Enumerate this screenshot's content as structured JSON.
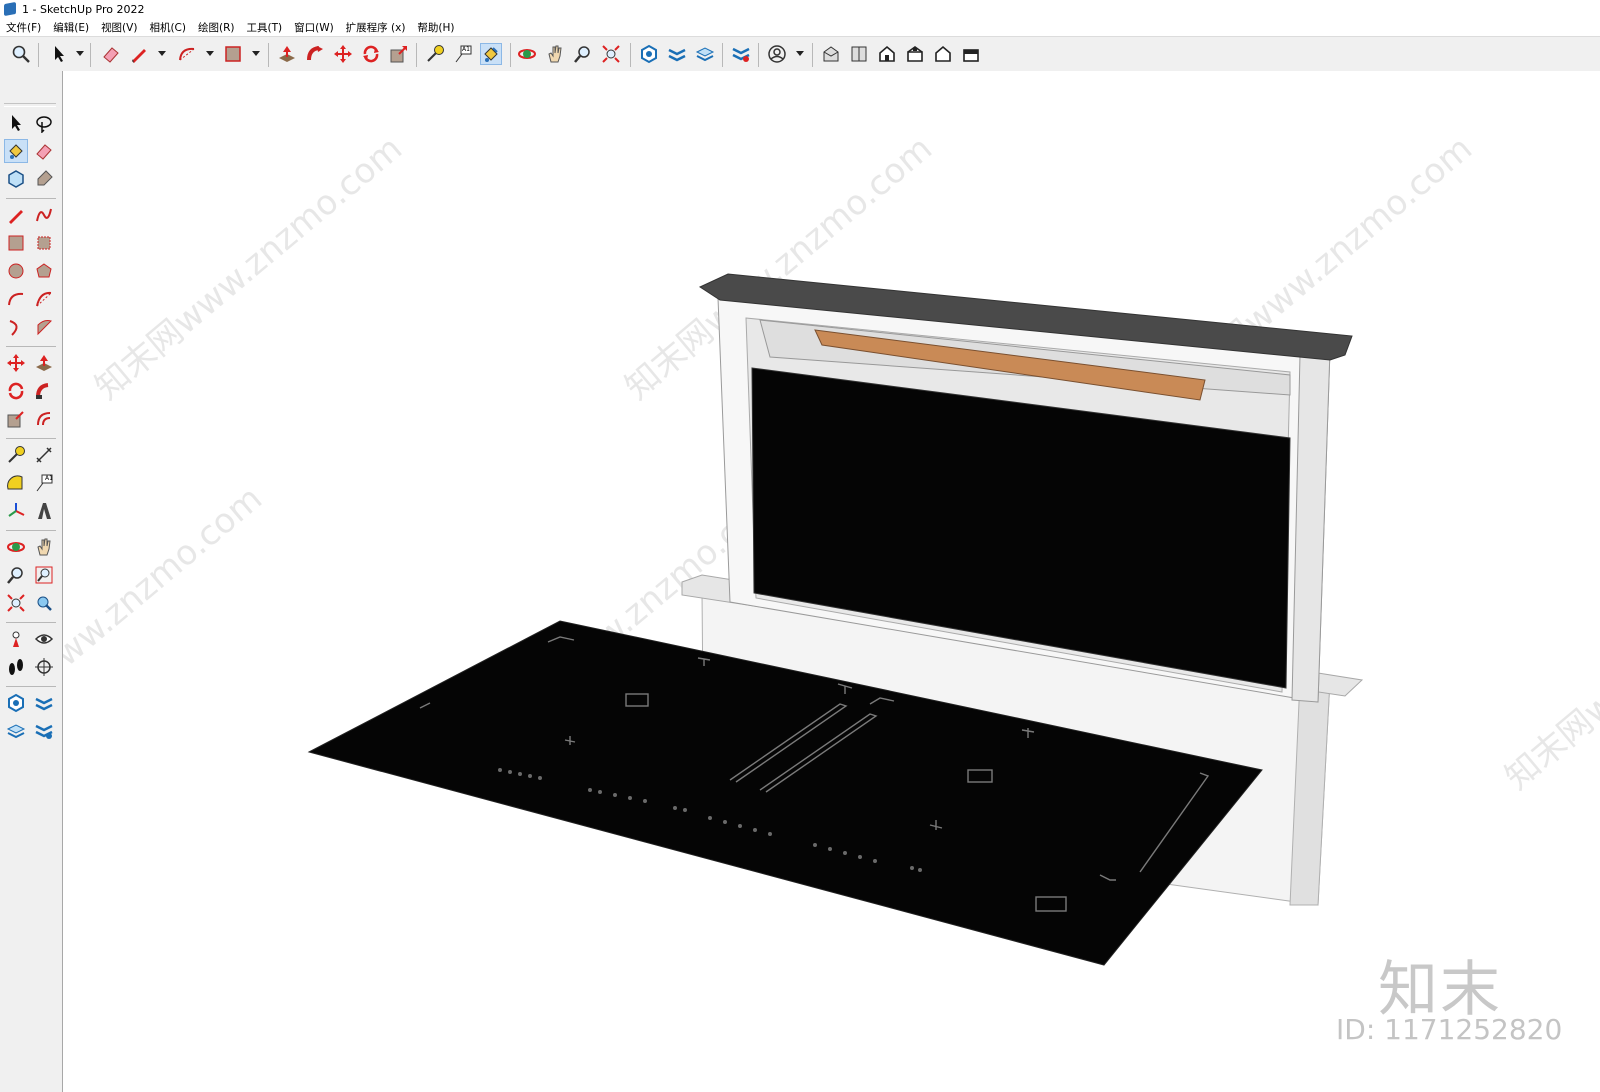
{
  "window": {
    "title": "1 - SketchUp Pro 2022"
  },
  "menubar": {
    "items": [
      "文件(F)",
      "编辑(E)",
      "视图(V)",
      "相机(C)",
      "绘图(R)",
      "工具(T)",
      "窗口(W)",
      "扩展程序 (x)",
      "帮助(H)"
    ]
  },
  "top_toolbar": {
    "icons": [
      "zoom-icon",
      "select-arrow-icon",
      "eraser-icon",
      "pencil-icon",
      "arc-icon",
      "rectangle-icon",
      "push-pull-icon",
      "follow-me-icon",
      "move-icon",
      "rotate-icon",
      "scale-icon",
      "tape-measure-icon",
      "text-icon",
      "paint-bucket-icon",
      "orbit-icon",
      "pan-icon",
      "zoom-tool-icon",
      "zoom-extents-icon",
      "warehouse-icon",
      "extension-warehouse-icon",
      "layout-icon",
      "styles-icon",
      "profile-icon",
      "iso-view-icon",
      "top-view-icon",
      "front-view-icon",
      "right-view-icon",
      "back-view-icon",
      "left-view-icon"
    ],
    "active": "paint-bucket-icon"
  },
  "left_toolbar": {
    "active": "paint-bucket-icon",
    "text_tool_label": "A1",
    "top_text_tool_label": "A1"
  },
  "colors": {
    "accent_active": "#c9e0f7",
    "glass": "#050505",
    "frame": "#f2f2f2",
    "lid": "#444444",
    "led_strip": "#c98a56"
  },
  "watermark": {
    "text": "知末网www.znzmo.com",
    "logo": "知末",
    "id_label": "ID: 1171252820"
  }
}
